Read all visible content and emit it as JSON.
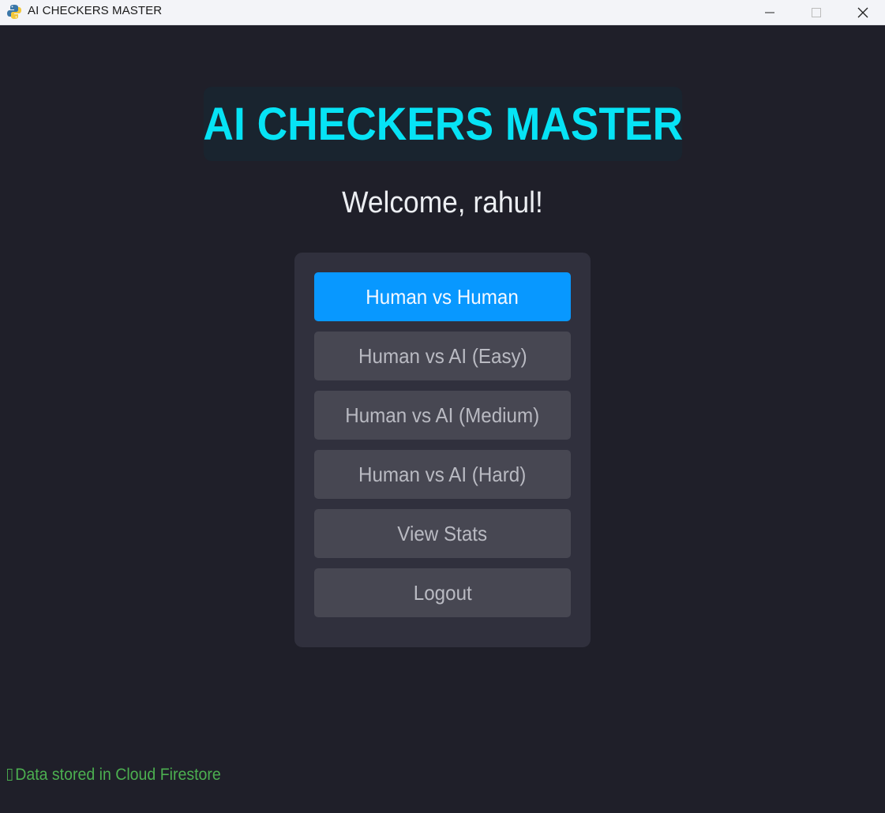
{
  "window": {
    "title": "AI CHECKERS MASTER",
    "icon": "python-icon",
    "controls": [
      "minimize-icon",
      "maximize-icon",
      "close-icon"
    ]
  },
  "header": {
    "title": "AI CHECKERS MASTER"
  },
  "welcome": {
    "text": "Welcome, rahul!"
  },
  "menu": {
    "items": [
      {
        "label": "Human vs Human",
        "active": true
      },
      {
        "label": "Human vs AI (Easy)",
        "active": false
      },
      {
        "label": "Human vs AI (Medium)",
        "active": false
      },
      {
        "label": "Human vs AI (Hard)",
        "active": false
      },
      {
        "label": "View Stats",
        "active": false
      },
      {
        "label": "Logout",
        "active": false
      }
    ]
  },
  "status": {
    "text": "Data stored in Cloud Firestore"
  },
  "colors": {
    "background": "#1f1f29",
    "title_box": "#19242f",
    "title_text": "#06e3f5",
    "panel": "#30303d",
    "button": "#474752",
    "button_active": "#0898ff",
    "status_text": "#4caf50"
  }
}
